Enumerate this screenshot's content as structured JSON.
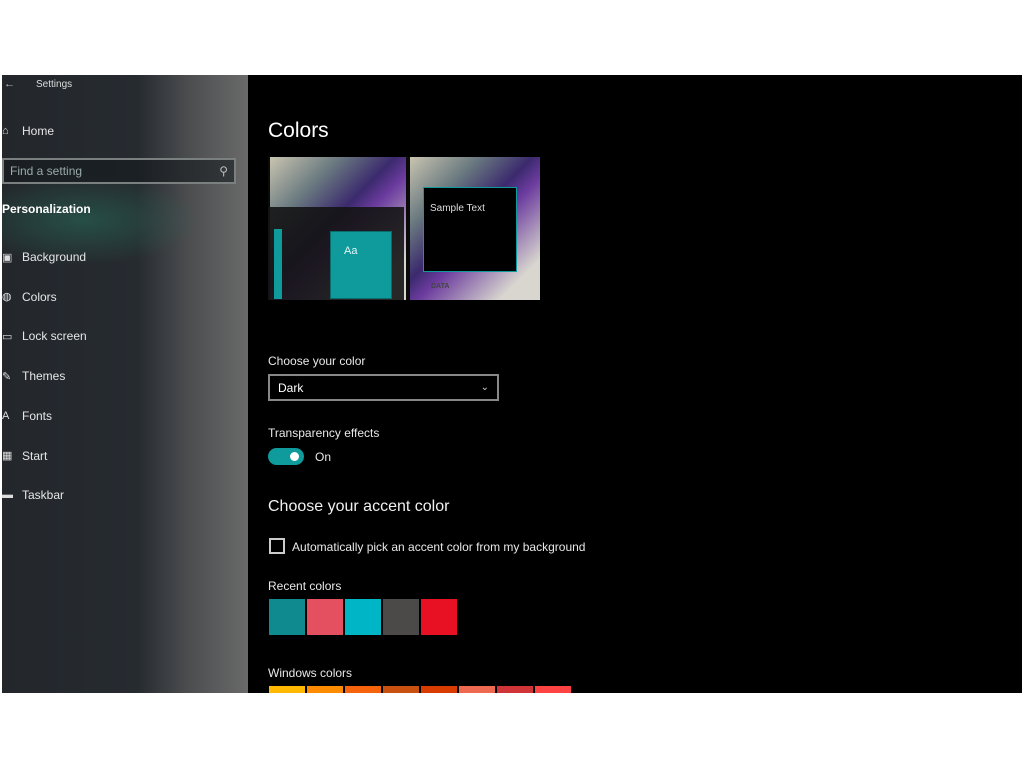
{
  "window": {
    "title": "Settings",
    "back_icon": "back-arrow-icon"
  },
  "sidebar": {
    "home": "Home",
    "search_placeholder": "Find a setting",
    "section": "Personalization",
    "items": [
      {
        "label": "Background",
        "icon": "image-icon"
      },
      {
        "label": "Colors",
        "icon": "palette-icon"
      },
      {
        "label": "Lock screen",
        "icon": "lock-screen-icon"
      },
      {
        "label": "Themes",
        "icon": "themes-icon"
      },
      {
        "label": "Fonts",
        "icon": "fonts-icon"
      },
      {
        "label": "Start",
        "icon": "start-icon"
      },
      {
        "label": "Taskbar",
        "icon": "taskbar-icon"
      }
    ]
  },
  "main": {
    "title": "Colors",
    "preview": {
      "sample_text": "Sample Text",
      "tile_text": "Aa",
      "logo_text": "DATA"
    },
    "choose_color": {
      "label": "Choose your color",
      "value": "Dark"
    },
    "transparency": {
      "label": "Transparency effects",
      "state": "On",
      "on": true
    },
    "accent_heading": "Choose your accent color",
    "auto_pick": {
      "label": "Automatically pick an accent color from my background",
      "checked": false
    },
    "recent_label": "Recent colors",
    "recent_colors": [
      "#0f8a8e",
      "#e4505f",
      "#00b5c6",
      "#4c4a48",
      "#e81123"
    ],
    "windows_label": "Windows colors",
    "windows_colors": [
      "#ffb900",
      "#ff8c00",
      "#f7630c",
      "#ca5010",
      "#da3b01",
      "#ef6950",
      "#d13438",
      "#ff4343"
    ],
    "accent": "#0f9b9b"
  }
}
